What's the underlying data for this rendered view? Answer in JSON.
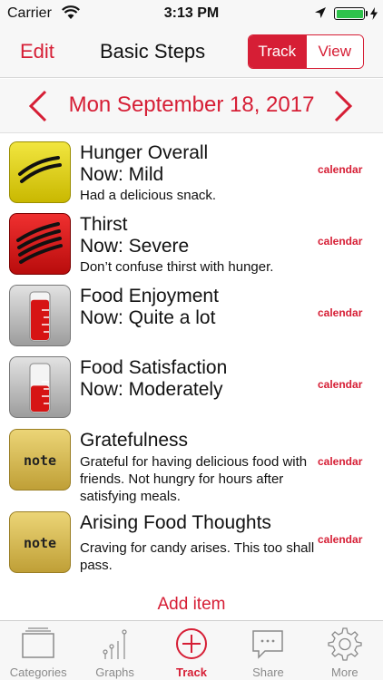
{
  "status": {
    "carrier": "Carrier",
    "time": "3:13 PM"
  },
  "nav": {
    "edit_label": "Edit",
    "title": "Basic Steps",
    "seg_track": "Track",
    "seg_view": "View"
  },
  "date_bar": {
    "date": "Mon September 18, 2017"
  },
  "items": [
    {
      "title": "Hunger Overall",
      "now": "Now: Mild",
      "note": "Had a delicious snack.",
      "calendar": "calendar",
      "icon": "hunger-mild-icon"
    },
    {
      "title": "Thirst",
      "now": "Now: Severe",
      "note": "Don’t confuse thirst with hunger.",
      "calendar": "calendar",
      "icon": "thirst-severe-icon"
    },
    {
      "title": "Food Enjoyment",
      "now": "Now: Quite a lot",
      "calendar": "calendar",
      "icon": "level-meter-icon",
      "level": 0.85
    },
    {
      "title": "Food Satisfaction",
      "now": "Now: Moderately",
      "calendar": "calendar",
      "icon": "level-meter-icon",
      "level": 0.55
    },
    {
      "title": "Gratefulness",
      "note": "Grateful for having delicious food with friends. Not hungry for hours after satisfying meals.",
      "calendar": "calendar",
      "icon": "note-icon",
      "icon_text": "note"
    },
    {
      "title": "Arising Food Thoughts",
      "note": "Craving for candy arises. This too shall pass.",
      "calendar": "calendar",
      "icon": "note-icon",
      "icon_text": "note"
    }
  ],
  "add_item": "Add item",
  "tabs": [
    {
      "label": "Categories",
      "icon": "categories-icon"
    },
    {
      "label": "Graphs",
      "icon": "graphs-icon"
    },
    {
      "label": "Track",
      "icon": "track-plus-icon",
      "active": true
    },
    {
      "label": "Share",
      "icon": "share-chat-icon"
    },
    {
      "label": "More",
      "icon": "gear-icon"
    }
  ],
  "colors": {
    "accent": "#d61e35",
    "yellow": "#e6d619",
    "red": "#d01616",
    "note_gold": "#d9bd55"
  }
}
